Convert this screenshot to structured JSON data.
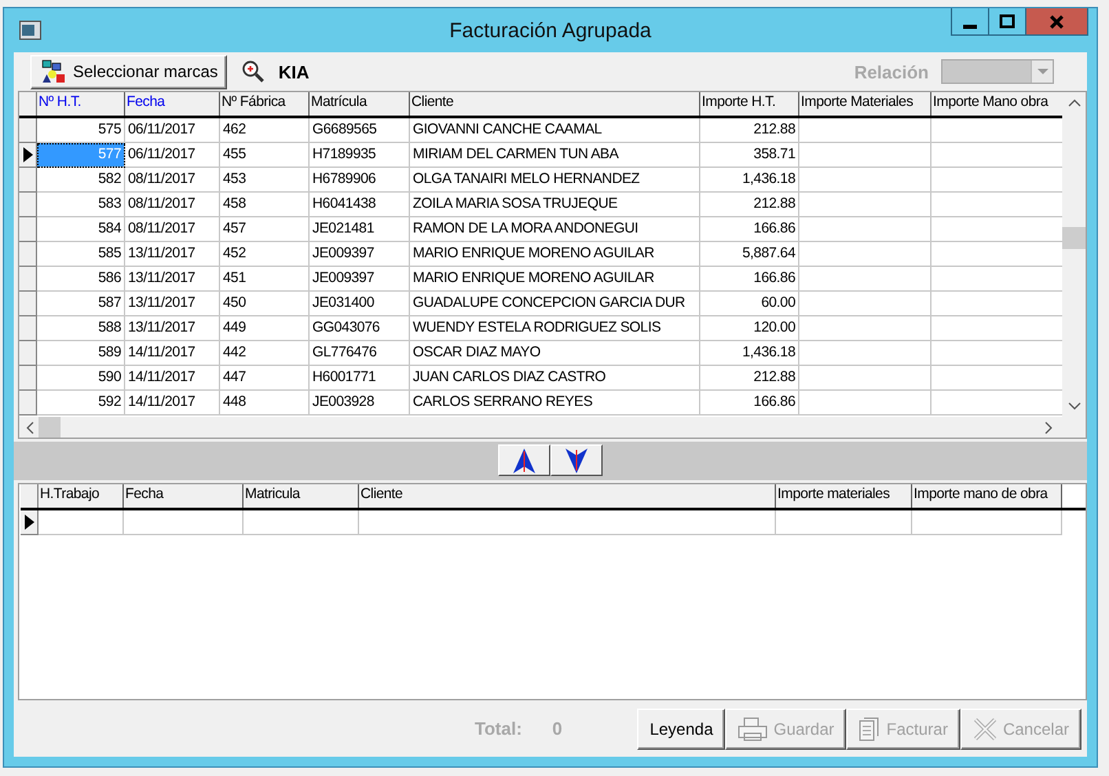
{
  "window": {
    "title": "Facturación Agrupada"
  },
  "toolbar": {
    "select_brands_button": "Seleccionar marcas",
    "brand": "KIA",
    "relation_label": "Relación",
    "relation_disabled": true
  },
  "invoices_table": {
    "columns": [
      {
        "label": "Nº H.T.",
        "sorted": true
      },
      {
        "label": "Fecha",
        "sorted": true
      },
      {
        "label": "Nº Fábrica",
        "sorted": false
      },
      {
        "label": "Matrícula",
        "sorted": false
      },
      {
        "label": "Cliente",
        "sorted": false
      },
      {
        "label": "Importe H.T.",
        "sorted": false
      },
      {
        "label": "Importe Materiales",
        "sorted": false
      },
      {
        "label": "Importe Mano obra",
        "sorted": false
      }
    ],
    "rows": [
      {
        "selected": false,
        "cells": [
          "575",
          "06/11/2017",
          "462",
          "G6689565",
          "GIOVANNI CANCHE CAAMAL",
          "212.88"
        ]
      },
      {
        "selected": true,
        "cells": [
          "577",
          "06/11/2017",
          "455",
          "H7189935",
          "MIRIAM DEL CARMEN TUN ABA",
          "358.71"
        ]
      },
      {
        "selected": false,
        "cells": [
          "582",
          "08/11/2017",
          "453",
          "H6789906",
          "OLGA TANAIRI MELO HERNANDEZ",
          "1,436.18"
        ]
      },
      {
        "selected": false,
        "cells": [
          "583",
          "08/11/2017",
          "458",
          "H6041438",
          "ZOILA MARIA SOSA TRUJEQUE",
          "212.88"
        ]
      },
      {
        "selected": false,
        "cells": [
          "584",
          "08/11/2017",
          "457",
          "JE021481",
          "RAMON DE LA MORA ANDONEGUI",
          "166.86"
        ]
      },
      {
        "selected": false,
        "cells": [
          "585",
          "13/11/2017",
          "452",
          "JE009397",
          "MARIO ENRIQUE MORENO AGUILAR",
          "5,887.64"
        ]
      },
      {
        "selected": false,
        "cells": [
          "586",
          "13/11/2017",
          "451",
          "JE009397",
          "MARIO ENRIQUE MORENO AGUILAR",
          "166.86"
        ]
      },
      {
        "selected": false,
        "cells": [
          "587",
          "13/11/2017",
          "450",
          "JE031400",
          "GUADALUPE CONCEPCION GARCIA DUR",
          "60.00"
        ]
      },
      {
        "selected": false,
        "cells": [
          "588",
          "13/11/2017",
          "449",
          "GG043076",
          "WUENDY ESTELA RODRIGUEZ SOLIS",
          "120.00"
        ]
      },
      {
        "selected": false,
        "cells": [
          "589",
          "14/11/2017",
          "442",
          "GL776476",
          "OSCAR DIAZ MAYO",
          "1,436.18"
        ]
      },
      {
        "selected": false,
        "cells": [
          "590",
          "14/11/2017",
          "447",
          "H6001771",
          "JUAN CARLOS DIAZ CASTRO",
          "212.88"
        ]
      },
      {
        "selected": false,
        "cells": [
          "592",
          "14/11/2017",
          "448",
          "JE003928",
          "CARLOS SERRANO REYES",
          "166.86"
        ]
      }
    ]
  },
  "grouped_table": {
    "columns": [
      "H.Trabajo",
      "Fecha",
      "Matricula",
      "Cliente",
      "Importe materiales",
      "Importe mano de obra"
    ]
  },
  "footer": {
    "total_label": "Total:",
    "total_value": "0",
    "buttons": [
      {
        "label": "Leyenda",
        "kind": "plain",
        "disabled": false
      },
      {
        "label": "Guardar",
        "kind": "save",
        "disabled": true
      },
      {
        "label": "Facturar",
        "kind": "invoice",
        "disabled": true
      },
      {
        "label": "Cancelar",
        "kind": "cancel",
        "disabled": true
      }
    ]
  }
}
